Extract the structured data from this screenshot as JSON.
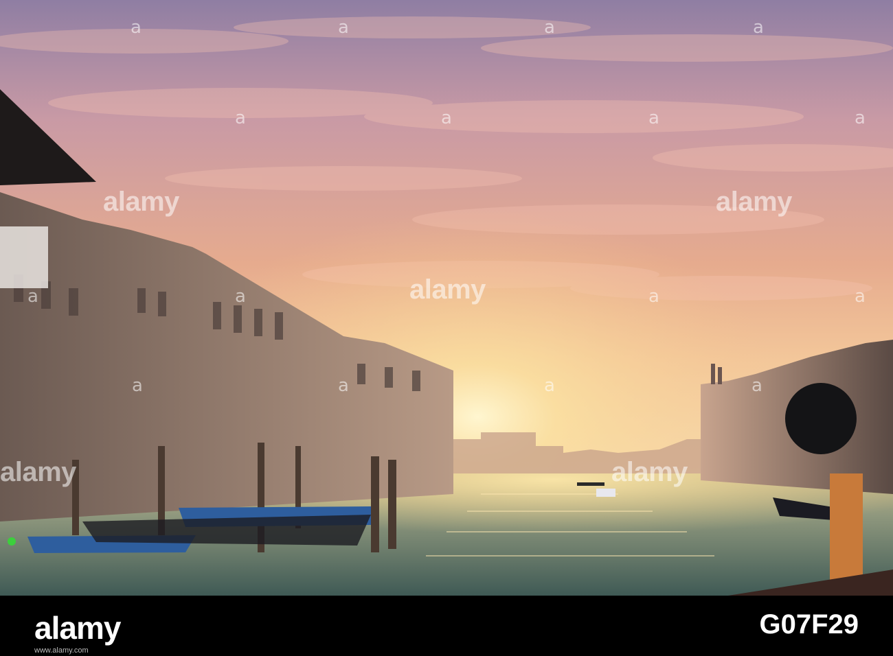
{
  "photo": {
    "subject": "",
    "colors": {
      "sky_top": "#9b86a6",
      "sky_mid": "#e3a98f",
      "sky_glow": "#f7d49a",
      "sun": "#fff3c4",
      "water": "#6f8a80",
      "water_glow": "#f2d28a",
      "gondola_cover": "#2e5e9e",
      "building_shadow": "#5c4a44"
    }
  },
  "watermark": {
    "text": "alamy"
  },
  "footer": {
    "brand": "alamy",
    "image_id": "G07F29",
    "credit": "www.alamy.com"
  }
}
